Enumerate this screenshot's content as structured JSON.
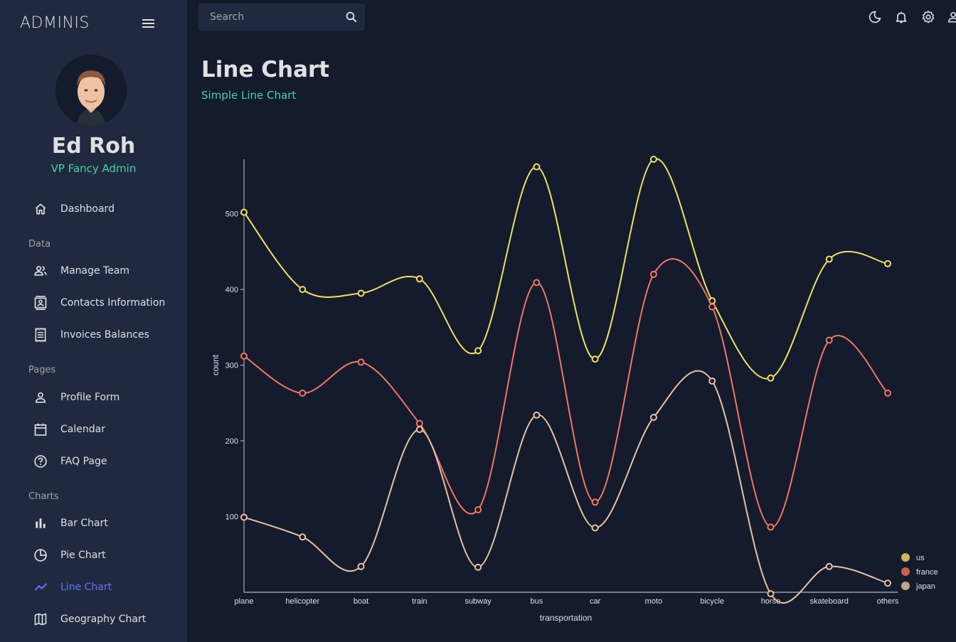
{
  "brand": "ADMINIS",
  "user": {
    "name": "Ed Roh",
    "role": "VP Fancy Admin"
  },
  "search": {
    "placeholder": "Search"
  },
  "nav": {
    "dashboard": "Dashboard",
    "section_data": "Data",
    "manage_team": "Manage Team",
    "contacts": "Contacts Information",
    "invoices": "Invoices Balances",
    "section_pages": "Pages",
    "profile": "Profile Form",
    "calendar": "Calendar",
    "faq": "FAQ Page",
    "section_charts": "Charts",
    "bar": "Bar Chart",
    "pie": "Pie Chart",
    "line": "Line Chart",
    "geography": "Geography Chart"
  },
  "header": {
    "title": "Line Chart",
    "subtitle": "Simple Line Chart"
  },
  "colors": {
    "accent": "#4cceac",
    "active": "#6870fa",
    "us": "#e8c1a0",
    "france": "#f47560",
    "japan": "#f1e15b"
  },
  "chart_data": {
    "type": "line",
    "xlabel": "transportation",
    "ylabel": "count",
    "categories": [
      "plane",
      "helicopter",
      "boat",
      "train",
      "subway",
      "bus",
      "car",
      "moto",
      "bicycle",
      "horse",
      "skateboard",
      "others"
    ],
    "ylim": [
      0,
      572
    ],
    "yticks": [
      100,
      200,
      300,
      400,
      500
    ],
    "legend_position": "bottom-right",
    "legend": [
      {
        "name": "us",
        "color": "#c7b95a"
      },
      {
        "name": "france",
        "color": "#c96152"
      },
      {
        "name": "japan",
        "color": "#c4a488"
      }
    ],
    "series": [
      {
        "color": "#f1e15b",
        "values": [
          502,
          400,
          395,
          414,
          319,
          562,
          308,
          572,
          385,
          283,
          440,
          434
        ]
      },
      {
        "color": "#f47560",
        "values": [
          312,
          263,
          304,
          223,
          109,
          409,
          119,
          420,
          377,
          86,
          333,
          263
        ]
      },
      {
        "color": "#e8c1a0",
        "values": [
          99,
          73,
          34,
          215,
          33,
          234,
          85,
          231,
          279,
          -2,
          34,
          12
        ]
      }
    ]
  }
}
